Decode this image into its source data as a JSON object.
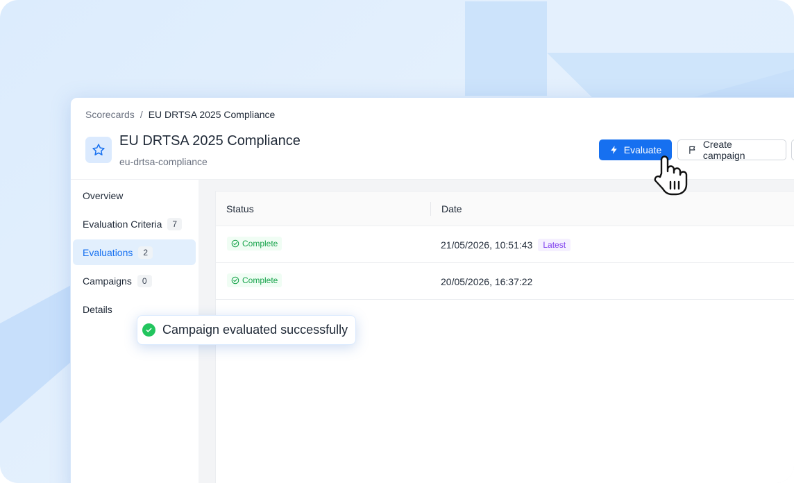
{
  "breadcrumb": {
    "root": "Scorecards",
    "separator": "/",
    "current": "EU DRTSA 2025 Compliance"
  },
  "header": {
    "title": "EU DRTSA 2025 Compliance",
    "slug": "eu-drtsa-compliance",
    "icon": "star-icon"
  },
  "toolbar": {
    "evaluate_label": "Evaluate",
    "create_campaign_label": "Create campaign"
  },
  "sidebar": {
    "items": [
      {
        "label": "Overview",
        "count": null
      },
      {
        "label": "Evaluation Criteria",
        "count": "7"
      },
      {
        "label": "Evaluations",
        "count": "2",
        "active": true
      },
      {
        "label": "Campaigns",
        "count": "0"
      },
      {
        "label": "Details",
        "count": null
      }
    ]
  },
  "table": {
    "columns": [
      "Status",
      "Date"
    ],
    "rows": [
      {
        "status": "Complete",
        "date": "21/05/2026, 10:51:43",
        "badge": "Latest"
      },
      {
        "status": "Complete",
        "date": "20/05/2026, 16:37:22",
        "badge": null
      }
    ]
  },
  "toast": {
    "message": "Campaign evaluated successfully"
  },
  "colors": {
    "accent": "#1670f0",
    "success": "#22c55e",
    "latest": "#7c3aed"
  }
}
